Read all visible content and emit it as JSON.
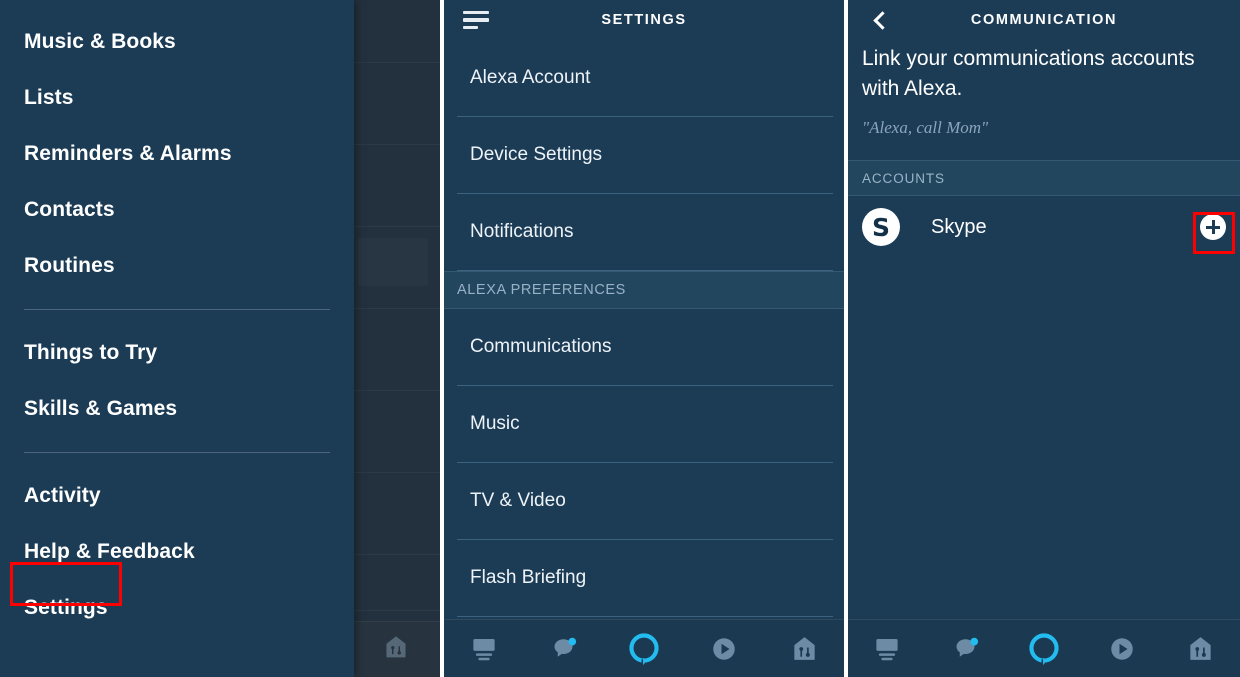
{
  "colors": {
    "panel_bg": "#1c3c56",
    "band_bg": "#23465f",
    "dim_bg": "#23313f",
    "highlight": "#ff0000",
    "accent_cyan": "#22bcf0",
    "tab_inactive": "#5b7d99"
  },
  "left_panel": {
    "name": "alexa-navigation-drawer",
    "items": [
      {
        "label": "Music & Books",
        "highlighted": false
      },
      {
        "label": "Lists",
        "highlighted": false
      },
      {
        "label": "Reminders & Alarms",
        "highlighted": false
      },
      {
        "label": "Contacts",
        "highlighted": false
      },
      {
        "label": "Routines",
        "highlighted": false
      },
      {
        "divider": true
      },
      {
        "label": "Things to Try",
        "highlighted": false
      },
      {
        "label": "Skills & Games",
        "highlighted": false
      },
      {
        "divider": true
      },
      {
        "label": "Activity",
        "highlighted": false
      },
      {
        "label": "Help & Feedback",
        "highlighted": false
      },
      {
        "label": "Settings",
        "highlighted": true
      }
    ]
  },
  "mid_panel": {
    "header": {
      "title": "SETTINGS",
      "menu_icon": "hamburger-menu-icon"
    },
    "rows": [
      {
        "label": "Alexa Account",
        "type": "item",
        "highlighted": false
      },
      {
        "label": "Device Settings",
        "type": "item",
        "highlighted": false
      },
      {
        "label": "Notifications",
        "type": "item",
        "highlighted": false
      },
      {
        "label": "ALEXA PREFERENCES",
        "type": "section"
      },
      {
        "label": "Communications",
        "type": "item",
        "highlighted": true
      },
      {
        "label": "Music",
        "type": "item",
        "highlighted": false
      },
      {
        "label": "TV & Video",
        "type": "item",
        "highlighted": false
      },
      {
        "label": "Flash Briefing",
        "type": "item",
        "highlighted": false
      }
    ]
  },
  "right_panel": {
    "header": {
      "title": "COMMUNICATION",
      "back_icon": "chevron-left-icon"
    },
    "lede": "Link your communications accounts with Alexa.",
    "quote": "\"Alexa, call Mom\"",
    "accounts_section_label": "ACCOUNTS",
    "accounts": [
      {
        "name": "Skype",
        "icon": "skype-icon",
        "icon_glyph": "S",
        "action": "add",
        "action_highlighted": true
      }
    ]
  },
  "tabbar": {
    "name": "bottom-tab-bar",
    "tabs": [
      {
        "icon": "devices-icon",
        "active": false
      },
      {
        "icon": "communicate-bubble-icon",
        "active": false,
        "badge": true
      },
      {
        "icon": "alexa-ring-icon",
        "active": true
      },
      {
        "icon": "play-icon",
        "active": false
      },
      {
        "icon": "smart-home-icon",
        "active": false
      }
    ]
  }
}
